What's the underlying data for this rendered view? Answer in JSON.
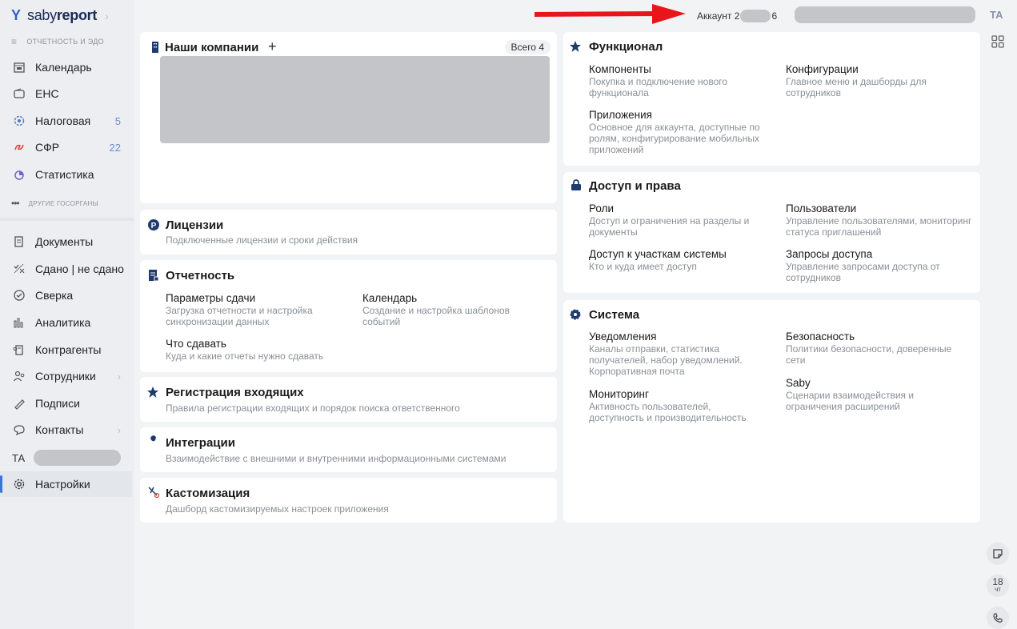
{
  "app": {
    "brand_light": "saby",
    "brand_bold": "report"
  },
  "sidebar": {
    "section_top": "ОТЧЕТНОСТЬ И ЭДО",
    "items_top": [
      {
        "label": "Календарь",
        "icon": "calendar-icon"
      },
      {
        "label": "ЕНС",
        "icon": "wallet-icon"
      },
      {
        "label": "Налоговая",
        "icon": "tax-office-icon",
        "count": "5"
      },
      {
        "label": "СФР",
        "icon": "sfr-icon",
        "count": "22"
      },
      {
        "label": "Статистика",
        "icon": "statistics-icon"
      }
    ],
    "section_other": "ДРУГИЕ ГОСОРГАНЫ",
    "items_bottom": [
      {
        "label": "Документы",
        "icon": "documents-icon"
      },
      {
        "label": "Сдано | не сдано",
        "icon": "submitted-icon"
      },
      {
        "label": "Сверка",
        "icon": "reconcile-icon"
      },
      {
        "label": "Аналитика",
        "icon": "analytics-icon"
      },
      {
        "label": "Контрагенты",
        "icon": "counterparties-icon"
      },
      {
        "label": "Сотрудники",
        "icon": "employees-icon"
      },
      {
        "label": "Подписи",
        "icon": "signature-icon"
      },
      {
        "label": "Контакты",
        "icon": "contacts-icon"
      }
    ],
    "user_initials": "ТА",
    "settings_label": "Настройки"
  },
  "topbar": {
    "account_prefix": "Аккаунт 2",
    "account_suffix": "6",
    "initials": "ТА"
  },
  "companies": {
    "title": "Наши компании",
    "total": "Всего 4"
  },
  "licenses": {
    "title": "Лицензии",
    "sub": "Подключенные лицензии и сроки действия"
  },
  "reporting": {
    "title": "Отчетность",
    "items": [
      {
        "title": "Параметры сдачи",
        "desc": "Загрузка отчетности и настройка синхронизации данных"
      },
      {
        "title": "Календарь",
        "desc": "Создание и настройка шаблонов событий"
      },
      {
        "title": "Что сдавать",
        "desc": "Куда и какие отчеты нужно сдавать"
      }
    ]
  },
  "incoming": {
    "title": "Регистрация входящих",
    "sub": "Правила регистрации входящих и порядок поиска ответственного"
  },
  "integrations": {
    "title": "Интеграции",
    "sub": "Взаимодействие с внешними и внутренними информационными системами"
  },
  "customization": {
    "title": "Кастомизация",
    "sub": "Дашборд кастомизируемых настроек приложения"
  },
  "functional": {
    "title": "Функционал",
    "items": [
      {
        "title": "Компоненты",
        "desc": "Покупка и подключение нового функционала"
      },
      {
        "title": "Конфигурации",
        "desc": "Главное меню и дашборды для сотрудников"
      },
      {
        "title": "Приложения",
        "desc": "Основное для аккаунта, доступные по ролям, конфигурирование мобильных приложений"
      }
    ]
  },
  "access": {
    "title": "Доступ и права",
    "items": [
      {
        "title": "Роли",
        "desc": "Доступ и ограничения на разделы и документы"
      },
      {
        "title": "Пользователи",
        "desc": "Управление пользователями, мониторинг статуса приглашений"
      },
      {
        "title": "Доступ к участкам системы",
        "desc": "Кто и куда имеет доступ"
      },
      {
        "title": "Запросы доступа",
        "desc": "Управление запросами доступа от сотрудников"
      }
    ]
  },
  "system": {
    "title": "Система",
    "items": [
      {
        "title": "Уведомления",
        "desc": "Каналы отправки, статистика получателей, набор уведомлений. Корпоративная почта"
      },
      {
        "title": "Безопасность",
        "desc": "Политики безопасности, доверенные сети"
      },
      {
        "title": "Мониторинг",
        "desc": "Активность пользователей, доступность и производительность"
      },
      {
        "title": "Saby",
        "desc": "Сценарии взаимодействия и ограничения расширений"
      }
    ]
  },
  "right_rail": {
    "day": "18",
    "weekday": "чт"
  },
  "colors": {
    "accent": "#3b74d9",
    "arrow": "#e8161b",
    "navy_icon": "#1f3a6b"
  }
}
